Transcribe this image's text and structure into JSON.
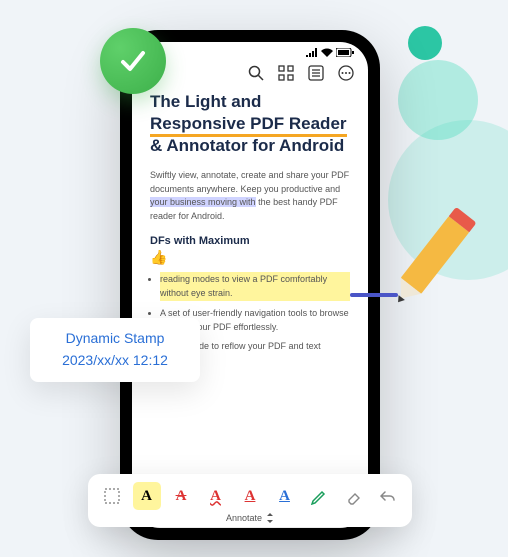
{
  "title": {
    "seg1": "The Light and ",
    "seg2": "Responsive PDF Reader",
    "seg3": " & Annotator for Android"
  },
  "paragraph": {
    "p1": "Swiftly view, annotate, create and share your PDF documents anywhere. Keep you productive and ",
    "p2": "your business moving with",
    "p3": " the best handy PDF reader for Android."
  },
  "subhead": "DFs with Maximum",
  "thumb_emoji": "👍",
  "bullets": {
    "b1": "reading modes to view a PDF comfortably without eye strain.",
    "b2": "A set of user-friendly navigation tools to browse through your PDF effortlessly.",
    "b3": "Liquid mode to reflow your PDF and text"
  },
  "stamp": {
    "title": "Dynamic Stamp",
    "time": "2023/xx/xx 12:12"
  },
  "toolbar": {
    "label": "Annotate"
  }
}
